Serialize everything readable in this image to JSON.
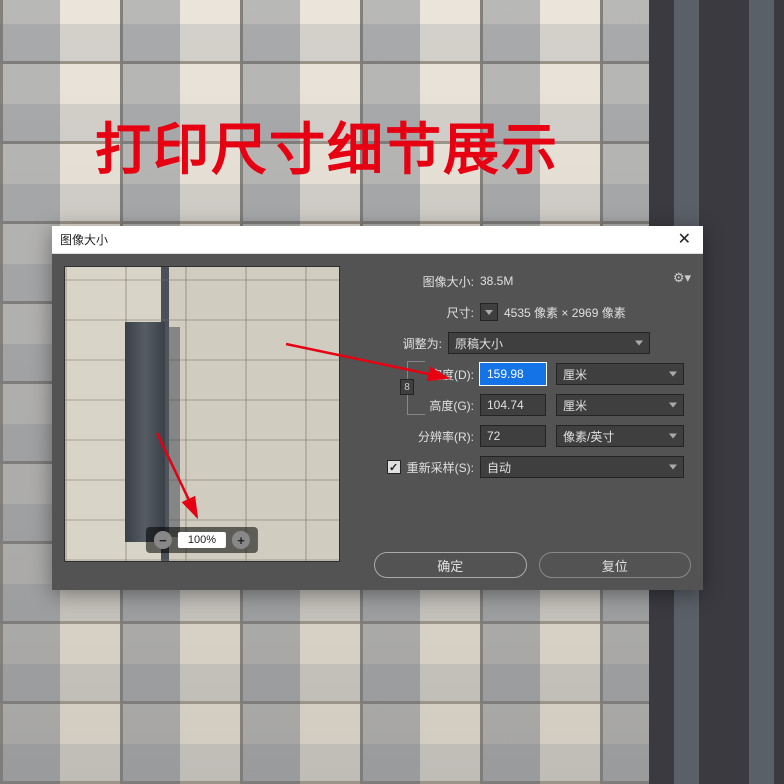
{
  "overlay_title": "打印尺寸细节展示",
  "dialog": {
    "title": "图像大小",
    "image_size_label": "图像大小:",
    "image_size_value": "38.5M",
    "dimensions_label": "尺寸:",
    "dimensions_value": "4535 像素 × 2969 像素",
    "fit_to_label": "调整为:",
    "fit_to_value": "原稿大小",
    "width_label": "宽度(D):",
    "width_value": "159.98",
    "width_unit": "厘米",
    "height_label": "高度(G):",
    "height_value": "104.74",
    "height_unit": "厘米",
    "resolution_label": "分辨率(R):",
    "resolution_value": "72",
    "resolution_unit": "像素/英寸",
    "resample_label": "重新采样(S):",
    "resample_value": "自动",
    "ok_label": "确定",
    "reset_label": "复位",
    "zoom_value": "100%",
    "link_icon": "8"
  }
}
